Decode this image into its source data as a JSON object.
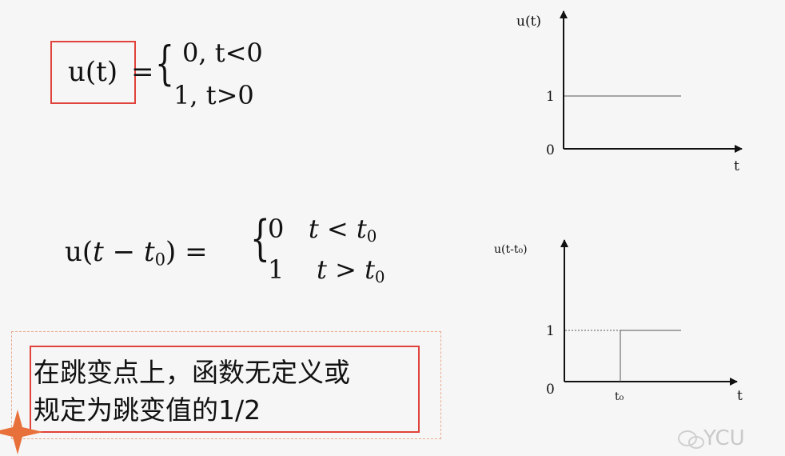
{
  "equation1": {
    "lhs": "u(t)",
    "equals": "=",
    "case1": "0, t<0",
    "case2": "1,   t>0"
  },
  "equation2": {
    "lhs_prefix": "u(",
    "lhs_var": "t − t",
    "lhs_sub": "0",
    "lhs_suffix": ") =",
    "case1_value": "0",
    "case1_condition": "t < t",
    "case1_sub": "0",
    "case2_value": "1",
    "case2_condition": "t > t",
    "case2_sub": "0"
  },
  "note": {
    "line1": "在跳变点上，函数无定义或",
    "line2": "规定为跳变值的1/2"
  },
  "graph1": {
    "y_label": "u(t)",
    "x_label": "t",
    "tick_one": "1",
    "tick_zero": "0"
  },
  "graph2": {
    "y_label": "u(t-t₀)",
    "x_label": "t",
    "tick_one": "1",
    "tick_zero": "0",
    "x_tick": "t₀"
  },
  "watermark": {
    "text": "YCU"
  },
  "colors": {
    "highlight_border": "#e0433b",
    "dashed_border": "#e8a98c",
    "star": "#e8703a"
  }
}
